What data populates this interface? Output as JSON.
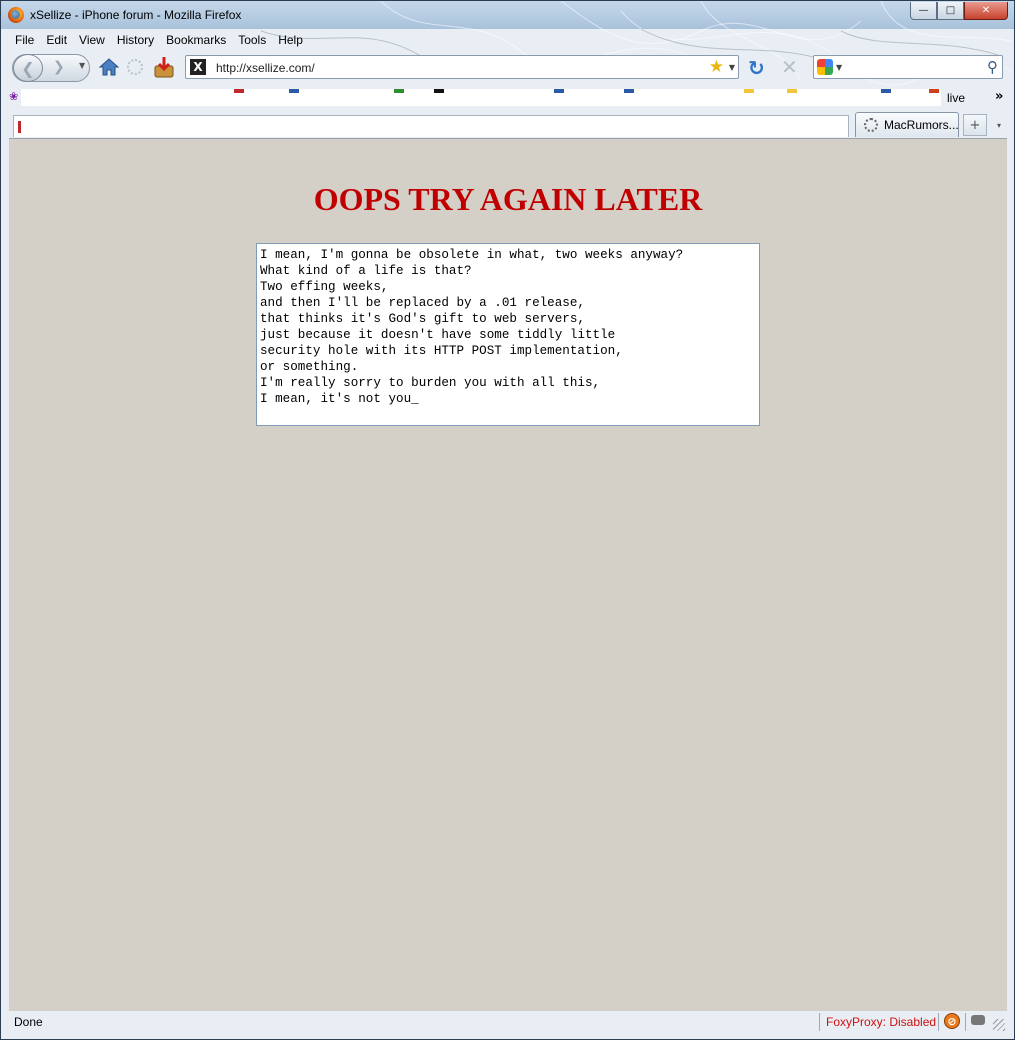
{
  "window": {
    "title": "xSellize - iPhone forum - Mozilla Firefox",
    "controls": {
      "minimize": "—",
      "maximize": "□",
      "close": "✕"
    }
  },
  "menu": [
    "File",
    "Edit",
    "View",
    "History",
    "Bookmarks",
    "Tools",
    "Help"
  ],
  "navbar": {
    "url": "http://xsellize.com/",
    "site_favicon": "X",
    "search_value": "",
    "icons": [
      "back-icon",
      "forward-icon",
      "home-icon",
      "download-icon",
      "star-icon",
      "refresh-icon",
      "stop-icon",
      "google-icon",
      "search-icon"
    ]
  },
  "bookmarks": {
    "live_label": "live",
    "more_label": "»"
  },
  "tabs": {
    "active_label": "MacRumors...",
    "new_tab_label": "+",
    "all_tabs_label": "▾"
  },
  "page": {
    "heading": "OOPS TRY AGAIN LATER",
    "message": "I mean, I'm gonna be obsolete in what, two weeks anyway?\nWhat kind of a life is that?\nTwo effing weeks,\nand then I'll be replaced by a .01 release,\nthat thinks it's God's gift to web servers,\njust because it doesn't have some tiddly little\nsecurity hole with its HTTP POST implementation,\nor something.\nI'm really sorry to burden you with all this,\nI mean, it's not you_",
    "background_color": "#d4d0c8",
    "heading_color": "#c00000"
  },
  "status": {
    "text": "Done",
    "foxyproxy": "FoxyProxy: Disabled"
  }
}
